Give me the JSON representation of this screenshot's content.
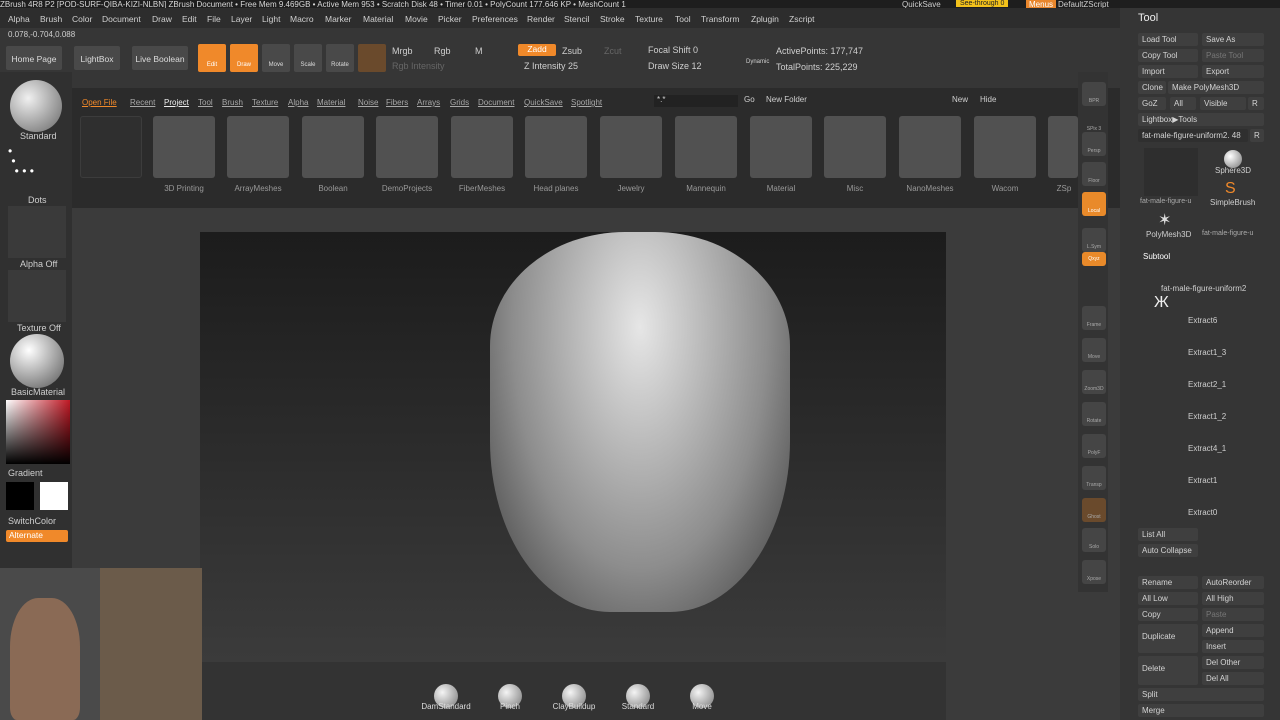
{
  "title": "ZBrush 4R8 P2 [POD-SURF-QIBA-KIZI-NLBN]  ZBrush Document   • Free Mem 9.469GB • Active Mem 953 • Scratch Disk 48 • Timer 0.01 • PolyCount 177.646 KP • MeshCount 1",
  "quicksave": "QuickSave",
  "seethrough": "See-through  0",
  "menus": "Menus",
  "defaultscript": "DefaultZScript",
  "menu": [
    "Alpha",
    "Brush",
    "Color",
    "Document",
    "Draw",
    "Edit",
    "File",
    "Layer",
    "Light",
    "Macro",
    "Marker",
    "Material",
    "Movie",
    "Picker",
    "Preferences",
    "Render",
    "Stencil",
    "Stroke",
    "Texture",
    "Tool",
    "Transform",
    "Zplugin",
    "Zscript"
  ],
  "coords": "0.078,-0.704,0.088",
  "shelf": {
    "home": "Home Page",
    "lightbox": "LightBox",
    "liveboolean": "Live Boolean",
    "edit": "Edit",
    "draw": "Draw",
    "move": "Move",
    "scale": "Scale",
    "rotate": "Rotate",
    "mrgb": "Mrgb",
    "rgb": "Rgb",
    "m": "M",
    "rgbint": "Rgb Intensity",
    "zadd": "Zadd",
    "zsub": "Zsub",
    "zcut": "Zcut",
    "zint": "Z Intensity 25",
    "focal": "Focal Shift 0",
    "drawsize": "Draw Size 12",
    "dynamic": "Dynamic",
    "active": "ActivePoints: 177,747",
    "total": "TotalPoints: 225,229"
  },
  "left": {
    "standard": "Standard",
    "dots": "Dots",
    "alpha": "Alpha Off",
    "texture": "Texture Off",
    "material": "BasicMaterial",
    "gradient": "Gradient",
    "switch": "SwitchColor",
    "alternate": "Alternate"
  },
  "lbtabs": [
    "Open File",
    "Recent",
    "Project",
    "Tool",
    "Brush",
    "Texture",
    "Alpha",
    "Material",
    "Noise",
    "Fibers",
    "Arrays",
    "Grids",
    "Document",
    "QuickSave",
    "Spotlight"
  ],
  "lbsearch": "*.*",
  "lbgo": "Go",
  "lbnew": "New Folder",
  "lbnewb": "New",
  "lbhide": "Hide",
  "folders": [
    "",
    "3D Printing",
    "ArrayMeshes",
    "Boolean",
    "DemoProjects",
    "FiberMeshes",
    "Head planes",
    "Jewelry",
    "Mannequin",
    "Material",
    "Misc",
    "NanoMeshes",
    "Wacom",
    "ZSp"
  ],
  "right": [
    "BPR",
    "SPix 3",
    "Persp",
    "Floor",
    "Local",
    "L.Sym",
    "Qxyz",
    "Frame",
    "Move",
    "Zoom3D",
    "Rotate",
    "PolyF",
    "Transp",
    "Ghost",
    "Solo",
    "Xpose"
  ],
  "tray": {
    "head": "Tool",
    "load": "Load Tool",
    "saveas": "Save As",
    "copy": "Copy Tool",
    "paste": "Paste Tool",
    "import": "Import",
    "export": "Export",
    "clone": "Clone",
    "make": "Make PolyMesh3D",
    "goz": "GoZ",
    "all": "All",
    "visible": "Visible",
    "r": "R",
    "lbtools": "Lightbox▶Tools",
    "current": "fat-male-figure-uniform2. 48",
    "sphere": "Sphere3D",
    "simple": "SimpleBrush",
    "poly": "PolyMesh3D",
    "fat": "fat-male-figure-u",
    "subtool": "Subtool",
    "listall": "List All",
    "autocollapse": "Auto Collapse",
    "rename": "Rename",
    "autoreorder": "AutoReorder",
    "alllow": "All Low",
    "allhigh": "All High",
    "copy2": "Copy",
    "paste2": "Paste",
    "duplicate": "Duplicate",
    "append": "Append",
    "insert": "Insert",
    "delete": "Delete",
    "delother": "Del Other",
    "delall": "Del All",
    "split": "Split",
    "merge": "Merge"
  },
  "subtools": [
    "fat-male-figure-uniform2",
    "Extract6",
    "Extract1_3",
    "Extract2_1",
    "Extract1_2",
    "Extract4_1",
    "Extract1",
    "Extract0"
  ],
  "brushes": [
    "DamStandard",
    "Pinch",
    "ClayBuildup",
    "Standard",
    "Move"
  ]
}
